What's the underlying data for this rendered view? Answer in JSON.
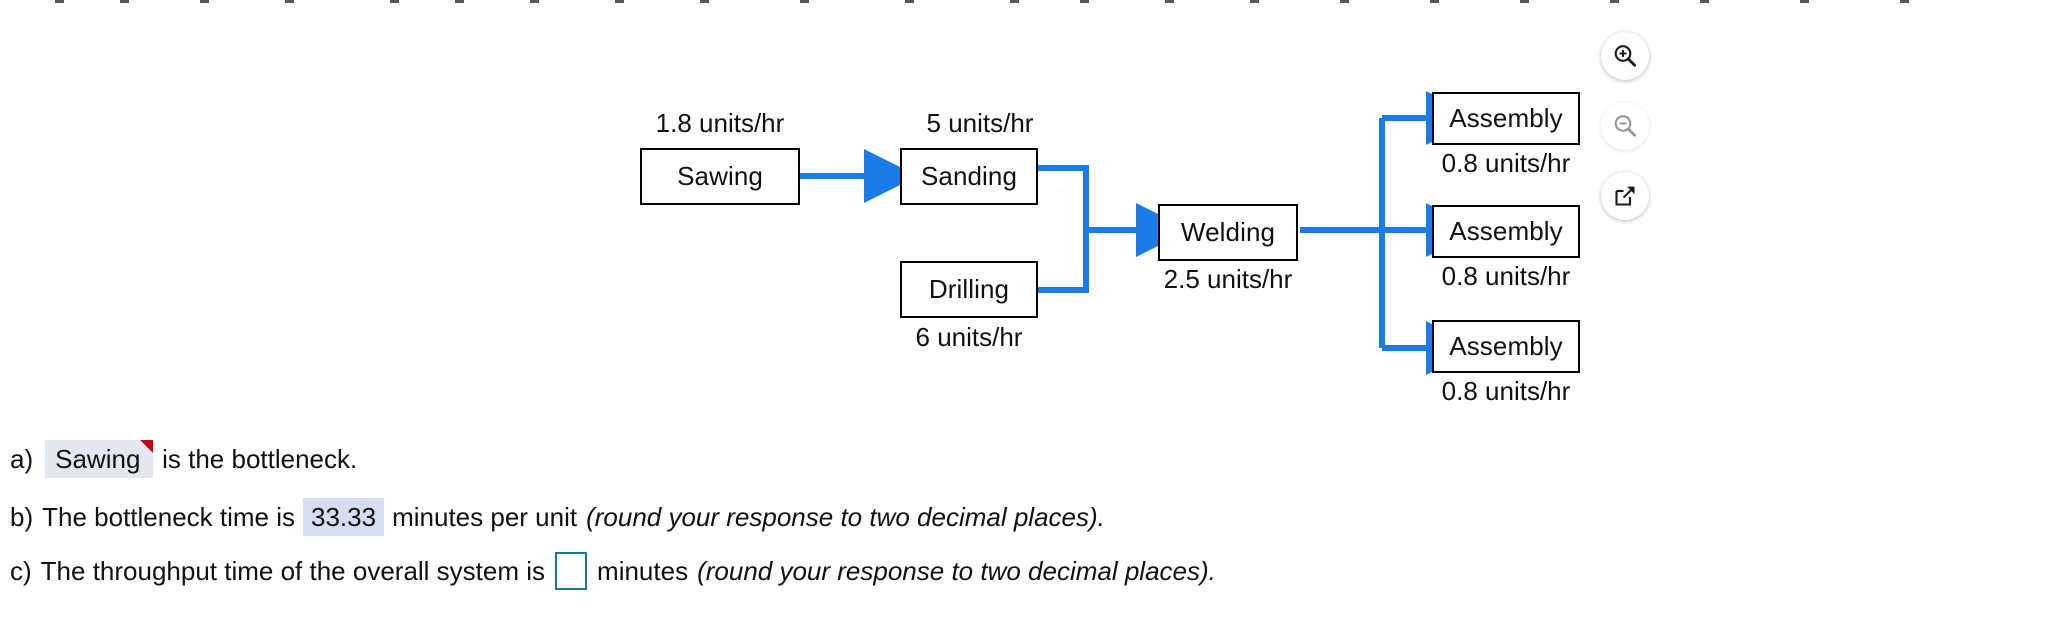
{
  "diagram": {
    "nodes": [
      {
        "id": "sawing",
        "label": "Sawing",
        "rate": "1.8 units/hr",
        "rate_pos": "above"
      },
      {
        "id": "sanding",
        "label": "Sanding",
        "rate": "5 units/hr",
        "rate_pos": "above"
      },
      {
        "id": "drilling",
        "label": "Drilling",
        "rate": "6 units/hr",
        "rate_pos": "below"
      },
      {
        "id": "welding",
        "label": "Welding",
        "rate": "2.5 units/hr",
        "rate_pos": "below"
      },
      {
        "id": "assembly1",
        "label": "Assembly",
        "rate": "0.8 units/hr",
        "rate_pos": "below"
      },
      {
        "id": "assembly2",
        "label": "Assembly",
        "rate": "0.8 units/hr",
        "rate_pos": "below"
      },
      {
        "id": "assembly3",
        "label": "Assembly",
        "rate": "0.8 units/hr",
        "rate_pos": "below"
      }
    ],
    "flow_color": "#1b7ce8",
    "box_border_color": "#000000"
  },
  "toolbar": {
    "buttons": [
      {
        "name": "zoom-in",
        "icon": "magnifier-plus-icon",
        "enabled": true
      },
      {
        "name": "zoom-out",
        "icon": "magnifier-minus-icon",
        "enabled": false
      },
      {
        "name": "open-in-new",
        "icon": "open-in-new-icon",
        "enabled": true
      }
    ]
  },
  "answers": {
    "a": {
      "marker": "a)",
      "value": "Sawing",
      "tail": "is the bottleneck.",
      "flag_color": "#c00418"
    },
    "b": {
      "marker": "b)",
      "lead": "The bottleneck time is",
      "value": "33.33",
      "mid": "minutes per unit",
      "hint": "(round your response to two decimal places)."
    },
    "c": {
      "marker": "c)",
      "lead": "The throughput time of the overall system is",
      "value": "",
      "placeholder": "",
      "mid": "minutes",
      "hint": "(round your response to two decimal places)."
    }
  }
}
